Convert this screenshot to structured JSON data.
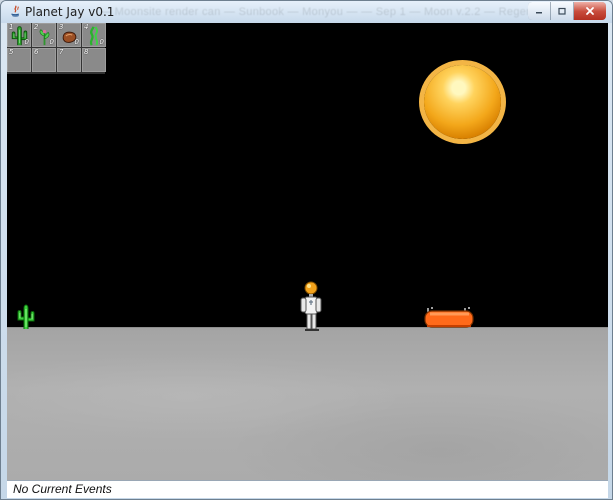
{
  "window": {
    "title": "Planet Jay v0.1",
    "ghost_title": "— Moonsite render can — Sunbook — Monyou — — Sep 1 — Moon v.2.2 — Regent",
    "controls": [
      "minimize",
      "maximize",
      "close"
    ]
  },
  "colors": {
    "window_chrome": "#dce8f3",
    "sky": "#000000",
    "ground": "#aaaaaa",
    "sun": "#f3a71a",
    "rover": "#ff6a1a",
    "cactus": "#32b332",
    "status_background": "#ffffff"
  },
  "inventory": {
    "slots": [
      {
        "number": "1",
        "item_icon": "cactus-icon",
        "count": "0"
      },
      {
        "number": "2",
        "item_icon": "sprout-icon",
        "count": "0"
      },
      {
        "number": "3",
        "item_icon": "rock-icon",
        "count": "0"
      },
      {
        "number": "4",
        "item_icon": "seaweed-icon",
        "count": "0"
      },
      {
        "number": "5",
        "item_icon": "",
        "count": ""
      },
      {
        "number": "6",
        "item_icon": "",
        "count": ""
      },
      {
        "number": "7",
        "item_icon": "",
        "count": ""
      },
      {
        "number": "8",
        "item_icon": "",
        "count": ""
      }
    ]
  },
  "scene": {
    "sun_icon": "sun-icon",
    "player_icon": "astronaut-icon",
    "rover_icon": "rover-icon",
    "plant_icon": "cactus-icon"
  },
  "status": {
    "text": "No Current Events"
  }
}
